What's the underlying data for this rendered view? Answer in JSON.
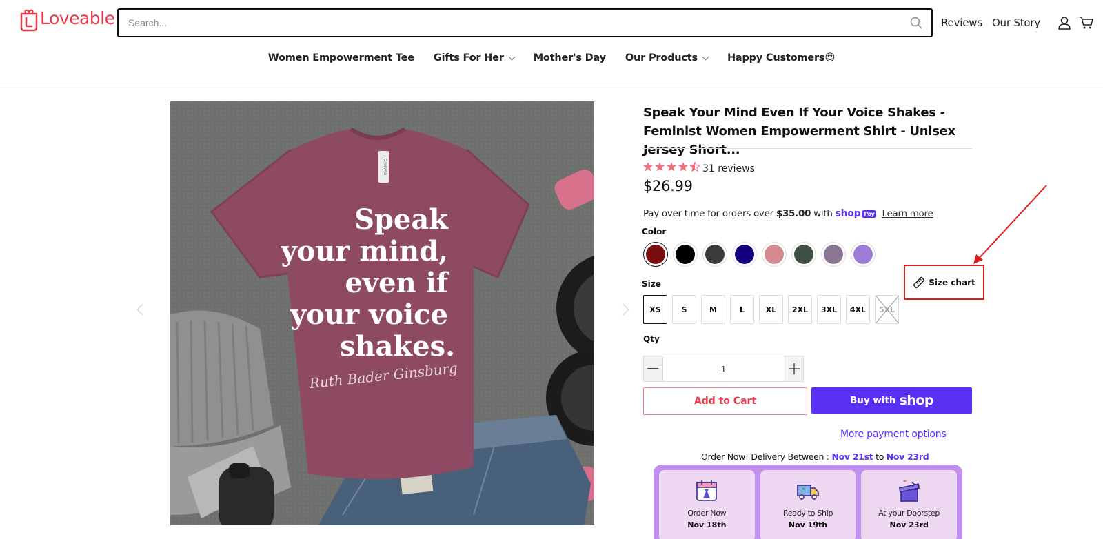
{
  "header": {
    "logo_text": "Loveable",
    "search_placeholder": "Search...",
    "links": [
      "Reviews",
      "Our Story"
    ]
  },
  "nav": {
    "items": [
      {
        "label": "Women Empowerment Tee",
        "dropdown": false
      },
      {
        "label": "Gifts For Her",
        "dropdown": true
      },
      {
        "label": "Mother's Day",
        "dropdown": false
      },
      {
        "label": "Our Products",
        "dropdown": true
      },
      {
        "label": "Happy Customers😍",
        "dropdown": false
      }
    ]
  },
  "product": {
    "image": {
      "shirt_text_lines": [
        "Speak",
        "your mind,",
        "even if",
        "your voice",
        "shakes."
      ],
      "signature": "Ruth Bader Ginsburg",
      "tag_text": "CANVAS",
      "shirt_color": "#8e4a63"
    },
    "title": "Speak Your Mind Even If Your Voice Shakes - Feminist Women Empowerment Shirt - Unisex Jersey Short...",
    "rating": {
      "stars": 4.5,
      "reviews_label": "31 reviews"
    },
    "price": "$26.99",
    "installments": {
      "prefix": "Pay over time for orders over",
      "amount": "$35.00",
      "with": "with",
      "shop": "shop",
      "pay": "Pay",
      "learn_more": "Learn more"
    },
    "color_label": "Color",
    "colors": [
      {
        "name": "maroon",
        "hex": "#7a0e0e",
        "selected": true
      },
      {
        "name": "black",
        "hex": "#000000",
        "selected": false
      },
      {
        "name": "charcoal",
        "hex": "#3b3b3b",
        "selected": false
      },
      {
        "name": "navy",
        "hex": "#14007f",
        "selected": false
      },
      {
        "name": "rose",
        "hex": "#d58a8f",
        "selected": false
      },
      {
        "name": "forest",
        "hex": "#3f4f43",
        "selected": false
      },
      {
        "name": "heather-purple",
        "hex": "#8a7592",
        "selected": false
      },
      {
        "name": "lavender",
        "hex": "#9d7bd6",
        "selected": false
      }
    ],
    "size_label": "Size",
    "sizes": [
      {
        "label": "XS",
        "selected": true,
        "available": true
      },
      {
        "label": "S",
        "selected": false,
        "available": true
      },
      {
        "label": "M",
        "selected": false,
        "available": true
      },
      {
        "label": "L",
        "selected": false,
        "available": true
      },
      {
        "label": "XL",
        "selected": false,
        "available": true
      },
      {
        "label": "2XL",
        "selected": false,
        "available": true
      },
      {
        "label": "3XL",
        "selected": false,
        "available": true
      },
      {
        "label": "4XL",
        "selected": false,
        "available": true
      },
      {
        "label": "5XL",
        "selected": false,
        "available": false
      }
    ],
    "size_chart_label": "Size chart",
    "qty_label": "Qty",
    "qty_value": "1",
    "add_to_cart": "Add to Cart",
    "buy_with": "Buy with",
    "buy_shop": "shop",
    "more_payment": "More payment options"
  },
  "delivery": {
    "prefix": "Order Now! Delivery Between :",
    "start": "Nov 21st",
    "to": "to",
    "end": "Nov 23rd",
    "steps": [
      {
        "label": "Order Now",
        "date": "Nov 18th",
        "icon": "calendar-dress-icon"
      },
      {
        "label": "Ready to Ship",
        "date": "Nov 19th",
        "icon": "delivery-truck-icon"
      },
      {
        "label": "At your Doorstep",
        "date": "Nov 23rd",
        "icon": "gift-box-icon"
      }
    ]
  },
  "colors": {
    "brand": "#e63b4a",
    "shop_purple": "#5a31f4",
    "annotation_red": "#e01b1b",
    "timeline_bg": "#c291f0",
    "step_bg": "#efd9f2"
  }
}
